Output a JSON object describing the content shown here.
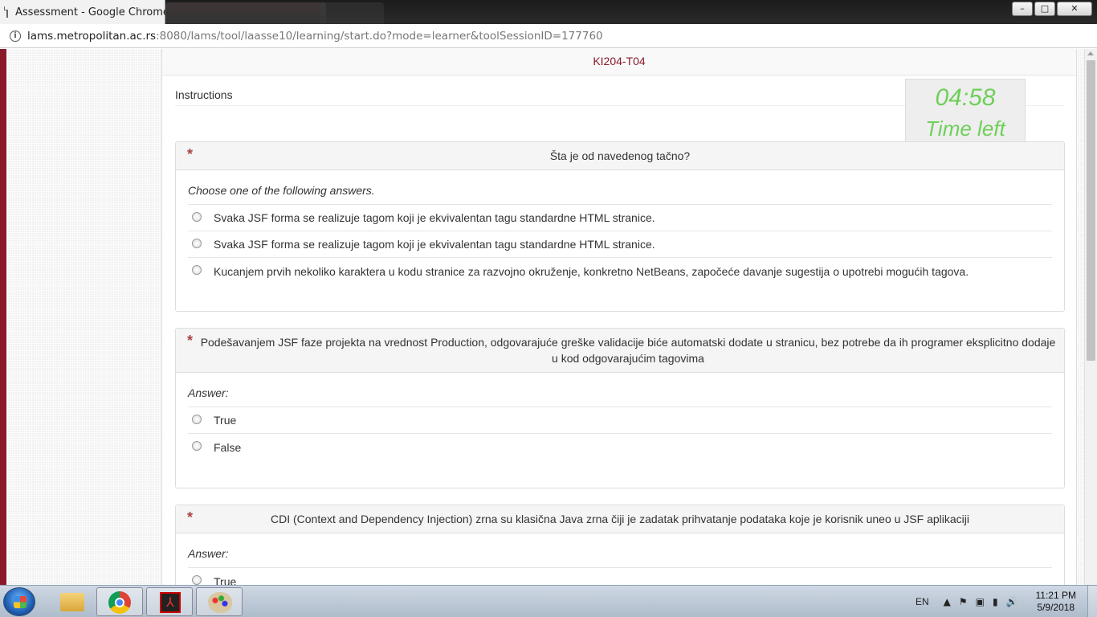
{
  "browser": {
    "tab_title": "Assessment - Google Chrome",
    "url_host": "lams.metropolitan.ac.rs",
    "url_rest": ":8080/lams/tool/laasse10/learning/start.do?mode=learner&toolSessionID=177760",
    "controls": {
      "minimize": "–",
      "maximize": "□",
      "close": "✕"
    }
  },
  "page": {
    "header": "KI204-T04",
    "instructions": "Instructions",
    "timer": {
      "time": "04:58",
      "label": "Time left"
    }
  },
  "questions": [
    {
      "marker": "*",
      "title": "Šta je od navedenog tačno?",
      "hint": "Choose one of the following answers.",
      "options": [
        "Svaka JSF forma se realizuje tagom koji je ekvivalentan tagu standardne HTML stranice.",
        "Svaka JSF forma se realizuje tagom koji je ekvivalentan tagu standardne HTML stranice.",
        "Kucanjem prvih nekoliko karaktera u kodu stranice za razvojno okruženje, konkretno NetBeans, započeće davanje sugestija o upotrebi mogućih tagova."
      ]
    },
    {
      "marker": "*",
      "title": "Podešavanjem JSF faze projekta na vrednost Production, odgovarajuće greške validacije biće automatski dodate u stranicu, bez potrebe da ih programer eksplicitno dodaje u kod odgovarajućim tagovima",
      "hint": "Answer:",
      "options": [
        "True",
        "False"
      ]
    },
    {
      "marker": "*",
      "title": "CDI (Context and Dependency Injection) zrna su klasična Java zrna čiji je zadatak prihvatanje podataka koje je korisnik uneo u JSF aplikaciji",
      "hint": "Answer:",
      "options": [
        "True"
      ]
    }
  ],
  "taskbar": {
    "pdf_glyph": "⅄",
    "language": "EN",
    "tray_icons": [
      "▲",
      "⚑",
      "▣",
      "▮",
      "🔊"
    ],
    "time": "11:21 PM",
    "date": "5/9/2018"
  }
}
